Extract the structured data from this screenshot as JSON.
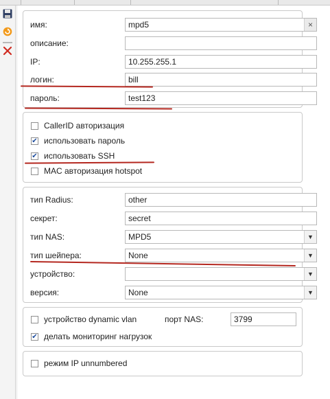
{
  "form": {
    "name_label": "имя:",
    "name_value": "mpd5",
    "clear_symbol": "×",
    "description_label": "описание:",
    "description_value": "",
    "ip_label": "IP:",
    "ip_value": "10.255.255.1",
    "login_label": "логин:",
    "login_value": "bill",
    "password_label": "пароль:",
    "password_value": "test123"
  },
  "options": {
    "callerid_label": "CallerID авторизация",
    "callerid_checked": false,
    "use_password_label": "использовать пароль",
    "use_password_checked": true,
    "use_ssh_label": "использовать SSH",
    "use_ssh_checked": true,
    "mac_label": "MAC авторизация hotspot",
    "mac_checked": false
  },
  "radius": {
    "radius_type_label": "тип Radius:",
    "radius_type_value": "other",
    "secret_label": "секрет:",
    "secret_value": "secret",
    "nas_type_label": "тип NAS:",
    "nas_type_value": "MPD5",
    "shaper_type_label": "тип шейпера:",
    "shaper_type_value": "None",
    "device_label": "устройство:",
    "device_value": "",
    "version_label": "версия:",
    "version_value": "None"
  },
  "vlan": {
    "dynamic_vlan_label": "устройство dynamic vlan",
    "dynamic_vlan_checked": false,
    "nas_port_label": "порт NAS:",
    "nas_port_value": "3799",
    "monitoring_label": "делать мониторинг нагрузок",
    "monitoring_checked": true
  },
  "unnumbered": {
    "ip_unnumbered_label": "режим IP unnumbered",
    "ip_unnumbered_checked": false
  },
  "toolbar": {
    "save_icon": "save-icon",
    "refresh_icon": "refresh-icon",
    "delete_icon": "delete-icon"
  },
  "colors": {
    "annotation_red": "#b4271f",
    "checkmark": "#1a4a9c",
    "panel_border": "#c9c9c9"
  }
}
